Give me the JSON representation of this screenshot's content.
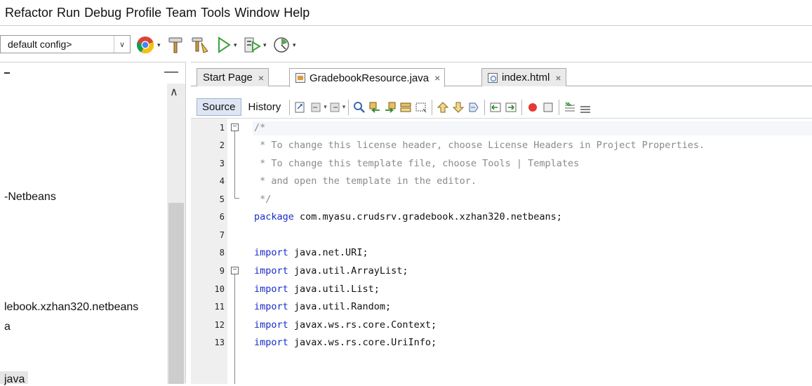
{
  "menu": [
    "Refactor",
    "Run",
    "Debug",
    "Profile",
    "Team",
    "Tools",
    "Window",
    "Help"
  ],
  "toolbar": {
    "config_value": "default config>",
    "icons": [
      "browser-icon",
      "build-icon",
      "clean-build-icon",
      "run-icon",
      "debug-icon",
      "profile-icon"
    ]
  },
  "left_panel": {
    "items": [
      "-Netbeans",
      "lebook.xzhan320.netbeans",
      "a",
      "java"
    ]
  },
  "tabs": [
    {
      "label": "Start Page",
      "close": "×"
    },
    {
      "label": "GradebookResource.java",
      "close": "×"
    },
    {
      "label": "index.html",
      "close": "×"
    }
  ],
  "editor_toolbar": {
    "source_label": "Source",
    "history_label": "History"
  },
  "code": {
    "line_numbers": [
      "1",
      "2",
      "3",
      "4",
      "5",
      "6",
      "7",
      "8",
      "9",
      "10",
      "11",
      "12",
      "13"
    ],
    "lines": [
      "/*",
      " * To change this license header, choose License Headers in Project Properties.",
      " * To change this template file, choose Tools | Templates",
      " * and open the template in the editor.",
      " */",
      "package com.myasu.crudsrv.gradebook.xzhan320.netbeans;",
      "",
      "import java.net.URI;",
      "import java.util.ArrayList;",
      "import java.util.List;",
      "import java.util.Random;",
      "import javax.ws.rs.core.Context;",
      "import javax.ws.rs.core.UriInfo;"
    ],
    "keywords": {
      "package": "package",
      "import": "import"
    }
  }
}
